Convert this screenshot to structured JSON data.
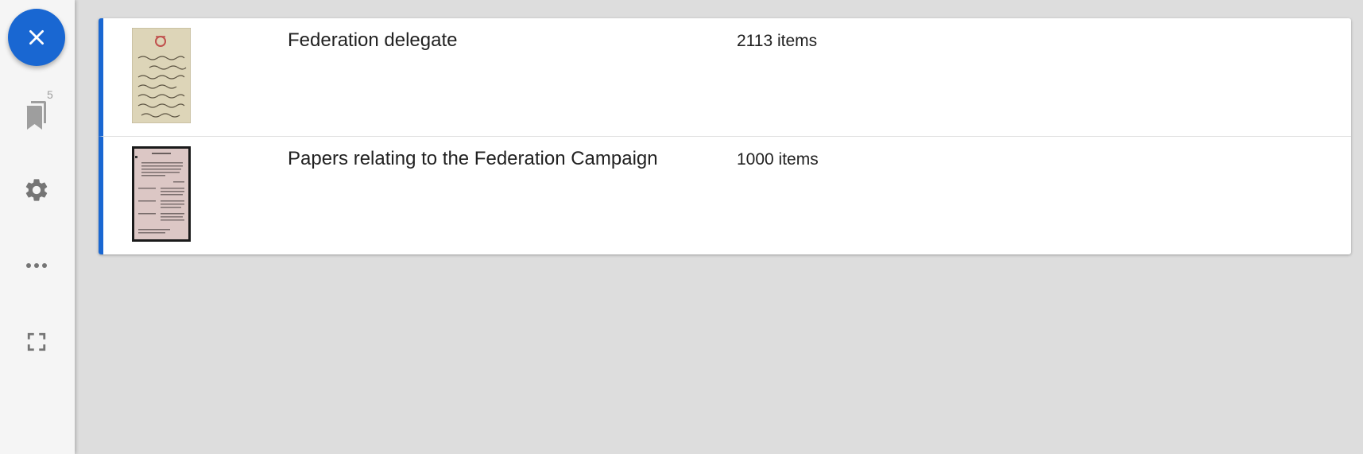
{
  "sidebar": {
    "close_icon": "close-icon",
    "bookmarks": {
      "icon": "bookmarks-icon",
      "badge": "5"
    },
    "settings_icon": "gear-icon",
    "more_icon": "more-horizontal-icon",
    "fullscreen_icon": "fullscreen-icon"
  },
  "list": {
    "items": [
      {
        "title": "Federation delegate",
        "count": "2113 items",
        "thumbnail": "handwritten-letter-thumbnail"
      },
      {
        "title": "Papers relating to the Federation Campaign",
        "count": "1000 items",
        "thumbnail": "typed-document-thumbnail"
      }
    ]
  },
  "colors": {
    "accent": "#1967d2",
    "background": "#dddddd",
    "sidebar": "#f5f5f5",
    "card": "#ffffff"
  }
}
